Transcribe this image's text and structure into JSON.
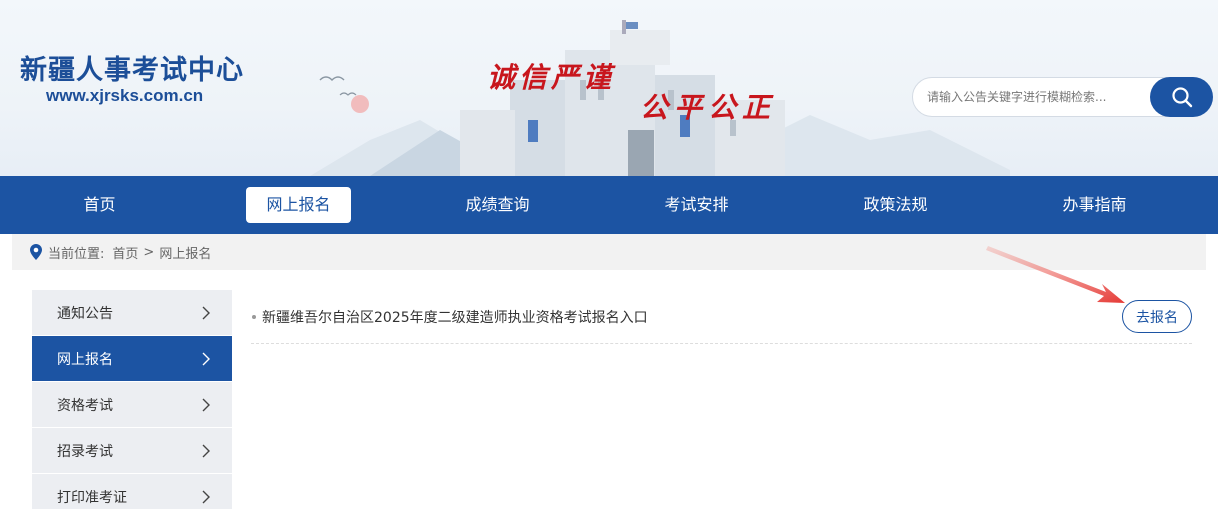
{
  "header": {
    "site_title": "新疆人事考试中心",
    "site_url": "www.xjrsks.com.cn",
    "motto_line1": "诚信严谨",
    "motto_line2": "公平公正"
  },
  "search": {
    "placeholder": "请输入公告关键字进行模糊检索...",
    "icon": "search-icon"
  },
  "nav": {
    "items": [
      {
        "label": "首页"
      },
      {
        "label": "网上报名"
      },
      {
        "label": "成绩查询"
      },
      {
        "label": "考试安排"
      },
      {
        "label": "政策法规"
      },
      {
        "label": "办事指南"
      }
    ],
    "active_index": 1
  },
  "breadcrumb": {
    "prefix": "当前位置:",
    "home": "首页",
    "separator": ">",
    "current": "网上报名"
  },
  "sidebar": {
    "items": [
      {
        "label": "通知公告"
      },
      {
        "label": "网上报名"
      },
      {
        "label": "资格考试"
      },
      {
        "label": "招录考试"
      },
      {
        "label": "打印准考证"
      }
    ],
    "active_index": 1
  },
  "list": {
    "rows": [
      {
        "title": "新疆维吾尔自治区2025年度二级建造师执业资格考试报名入口",
        "action": "去报名"
      }
    ]
  },
  "colors": {
    "primary": "#1c54a3",
    "motto": "#c8161d",
    "annotation_arrow": "#e53935"
  }
}
